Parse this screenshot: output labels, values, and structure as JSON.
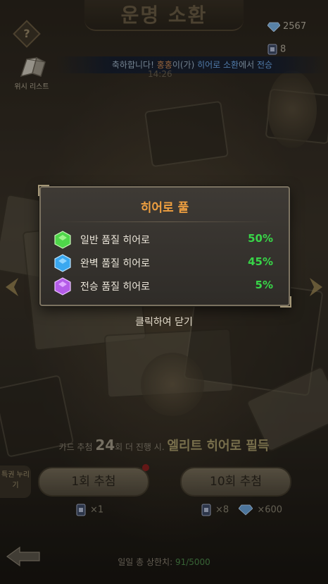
{
  "header": {
    "title": "운명 소환",
    "help_label": "?",
    "wishlist_label": "위시 리스트"
  },
  "currency": {
    "diamonds": "2567",
    "tickets": "8"
  },
  "notice": {
    "prefix": "축하합니다! ",
    "player": "홍홍",
    "middle": "이(가) ",
    "event": "히어로 소환",
    "suffix": "에서 ",
    "tier": "전승"
  },
  "timer": "14:26",
  "popup": {
    "title": "히어로 풀",
    "tiers": [
      {
        "label": "일반 품질 히어로",
        "percent": "50%",
        "gem_color": "#4fd64a",
        "icon": "green-gem-icon"
      },
      {
        "label": "완벽 품질 히어로",
        "percent": "45%",
        "gem_color": "#3aa8f0",
        "icon": "blue-gem-icon"
      },
      {
        "label": "전승 품질 히어로",
        "percent": "5%",
        "gem_color": "#b45ce8",
        "icon": "purple-gem-icon"
      }
    ],
    "close_hint": "클릭하여 닫기"
  },
  "guarantee": {
    "prefix": "카드 추첨 ",
    "count": "24",
    "middle": "회 더 진행 시. ",
    "reward": "엘리트 히어로 필득"
  },
  "privilege_label": "특권 누리기",
  "draw": {
    "single_label": "1회 추첨",
    "ten_label": "10회 추첨",
    "single_cost": "×1",
    "ten_ticket_cost": "×8",
    "ten_diamond_cost": "×600"
  },
  "daily_limit": {
    "prefix": "일일 총 상한치: ",
    "count": "91/5000"
  }
}
